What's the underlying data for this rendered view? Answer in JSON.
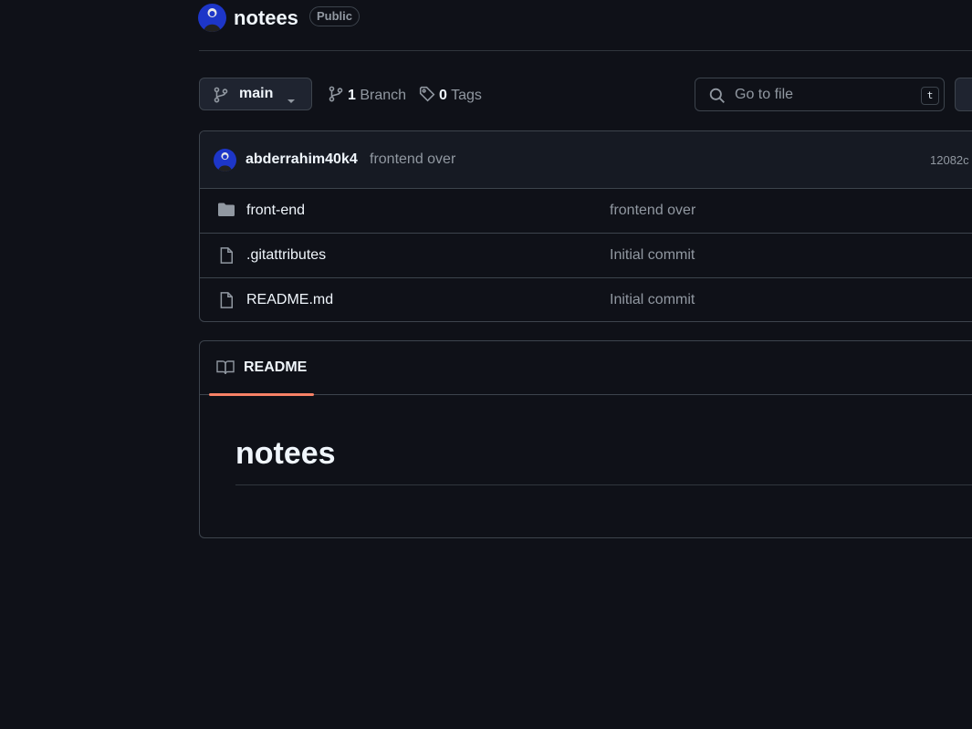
{
  "repo": {
    "name": "notees",
    "visibility": "Public"
  },
  "toolbar": {
    "branch": "main",
    "branch_count": "1",
    "branch_label": "Branch",
    "tag_count": "0",
    "tag_label": "Tags",
    "search_placeholder": "Go to file",
    "search_shortcut": "t"
  },
  "commit": {
    "author": "abderrahim40k4",
    "message": "frontend over",
    "sha": "12082c"
  },
  "files": [
    {
      "name": "front-end",
      "type": "folder",
      "message": "frontend over"
    },
    {
      "name": ".gitattributes",
      "type": "file",
      "message": "Initial commit"
    },
    {
      "name": "README.md",
      "type": "file",
      "message": "Initial commit"
    }
  ],
  "readme": {
    "tab_label": "README",
    "heading": "notees"
  },
  "colors": {
    "background": "#0f1118",
    "border": "#3d444d",
    "accent_underline": "#f78166",
    "avatar": "#1d36c8"
  }
}
